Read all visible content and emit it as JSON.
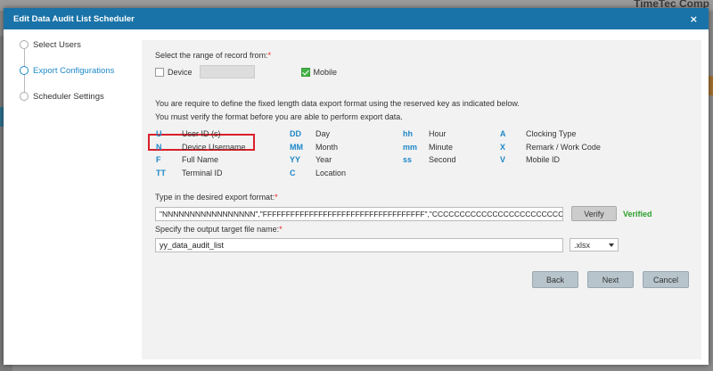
{
  "background": {
    "brand": "TimeTec Comp"
  },
  "modal": {
    "title": "Edit Data Audit List Scheduler",
    "close": "×"
  },
  "steps": [
    {
      "label": "Select Users",
      "active": false
    },
    {
      "label": "Export Configurations",
      "active": true
    },
    {
      "label": "Scheduler Settings",
      "active": false
    }
  ],
  "range": {
    "label": "Select the range of record from:",
    "required": "*",
    "device_label": "Device",
    "device_checked": false,
    "mobile_label": "Mobile",
    "mobile_checked": true
  },
  "instructions": {
    "line1": "You are require to define the fixed length data export format using the reserved key as indicated below.",
    "line2": "You must verify the format before you are able to perform export data."
  },
  "keys": [
    [
      {
        "key": "U",
        "value": "User ID (s)"
      },
      {
        "key": "DD",
        "value": "Day"
      },
      {
        "key": "hh",
        "value": "Hour"
      },
      {
        "key": "A",
        "value": "Clocking Type"
      }
    ],
    [
      {
        "key": "N",
        "value": "Device Username"
      },
      {
        "key": "MM",
        "value": "Month"
      },
      {
        "key": "mm",
        "value": "Minute"
      },
      {
        "key": "X",
        "value": "Remark / Work Code"
      }
    ],
    [
      {
        "key": "F",
        "value": "Full Name"
      },
      {
        "key": "YY",
        "value": "Year"
      },
      {
        "key": "ss",
        "value": "Second"
      },
      {
        "key": "V",
        "value": "Mobile ID"
      }
    ],
    [
      {
        "key": "TT",
        "value": "Terminal ID"
      },
      {
        "key": "C",
        "value": "Location"
      }
    ]
  ],
  "format": {
    "label": "Type in the desired export format:",
    "required": "*",
    "value": "\"NNNNNNNNNNNNNNNNN\",\"FFFFFFFFFFFFFFFFFFFFFFFFFFFFFFFFFFF\",\"CCCCCCCCCCCCCCCCCCCCCCCCCCCCCCCCCCC\"",
    "verify_label": "Verify",
    "status": "Verified"
  },
  "output": {
    "label": "Specify the output target file name:",
    "required": "*",
    "filename": "yy_data_audit_list",
    "extension": ".xlsx"
  },
  "buttons": {
    "back": "Back",
    "next": "Next",
    "cancel": "Cancel"
  },
  "colors": {
    "header": "#1a73a8",
    "accent": "#1e88c8",
    "verified": "#2ca02c",
    "highlight": "#d9202a"
  }
}
